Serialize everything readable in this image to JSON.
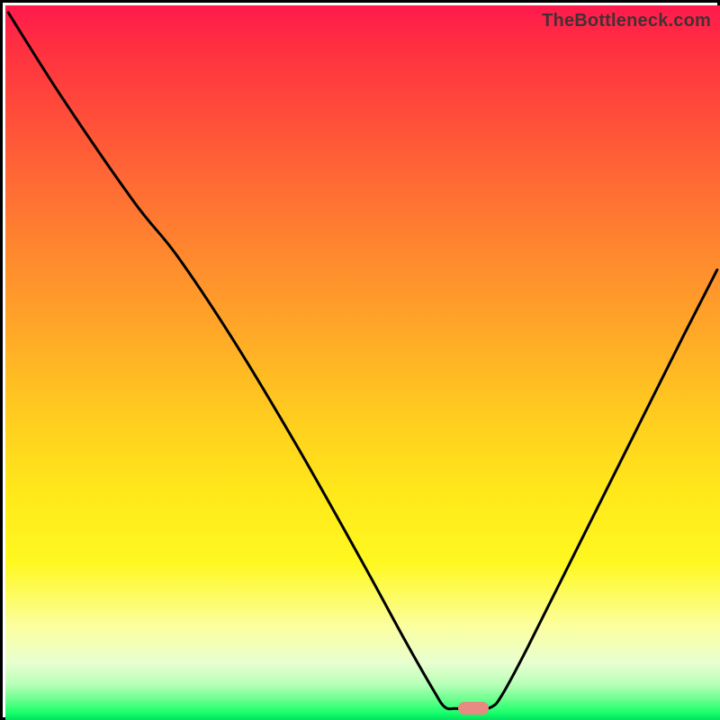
{
  "watermark": "TheBottleneck.com",
  "marker": {
    "x_pct": 65.5,
    "y_pct": 98.4,
    "color": "#e98a82"
  },
  "gradient_stops": [
    {
      "pct": 0,
      "color": "#ff1a4d"
    },
    {
      "pct": 6,
      "color": "#ff3040"
    },
    {
      "pct": 18,
      "color": "#ff5538"
    },
    {
      "pct": 32,
      "color": "#ff8030"
    },
    {
      "pct": 45,
      "color": "#ffa628"
    },
    {
      "pct": 56,
      "color": "#ffc820"
    },
    {
      "pct": 68,
      "color": "#ffe81a"
    },
    {
      "pct": 78,
      "color": "#fff820"
    },
    {
      "pct": 87,
      "color": "#fbffa0"
    },
    {
      "pct": 92,
      "color": "#e8ffd0"
    },
    {
      "pct": 95,
      "color": "#b8ffb8"
    },
    {
      "pct": 97,
      "color": "#70ff90"
    },
    {
      "pct": 99,
      "color": "#18ff6a"
    },
    {
      "pct": 100,
      "color": "#00e060"
    }
  ],
  "chart_data": {
    "type": "line",
    "title": "",
    "xlabel": "",
    "ylabel": "",
    "x_range_pct": [
      0,
      100
    ],
    "y_range_pct": [
      0,
      100
    ],
    "series": [
      {
        "name": "bottleneck-curve",
        "points_pct": [
          {
            "x": 0.4,
            "y": 1.0
          },
          {
            "x": 8.0,
            "y": 13.0
          },
          {
            "x": 18.0,
            "y": 27.5
          },
          {
            "x": 24.0,
            "y": 35.0
          },
          {
            "x": 32.0,
            "y": 47.0
          },
          {
            "x": 41.0,
            "y": 62.0
          },
          {
            "x": 50.0,
            "y": 78.0
          },
          {
            "x": 56.0,
            "y": 89.0
          },
          {
            "x": 60.0,
            "y": 96.0
          },
          {
            "x": 61.5,
            "y": 98.2
          },
          {
            "x": 63.0,
            "y": 98.4
          },
          {
            "x": 66.0,
            "y": 98.4
          },
          {
            "x": 68.0,
            "y": 98.2
          },
          {
            "x": 69.5,
            "y": 96.5
          },
          {
            "x": 73.0,
            "y": 90.0
          },
          {
            "x": 80.0,
            "y": 76.0
          },
          {
            "x": 88.0,
            "y": 60.0
          },
          {
            "x": 95.0,
            "y": 46.0
          },
          {
            "x": 99.6,
            "y": 37.0
          }
        ]
      }
    ]
  }
}
